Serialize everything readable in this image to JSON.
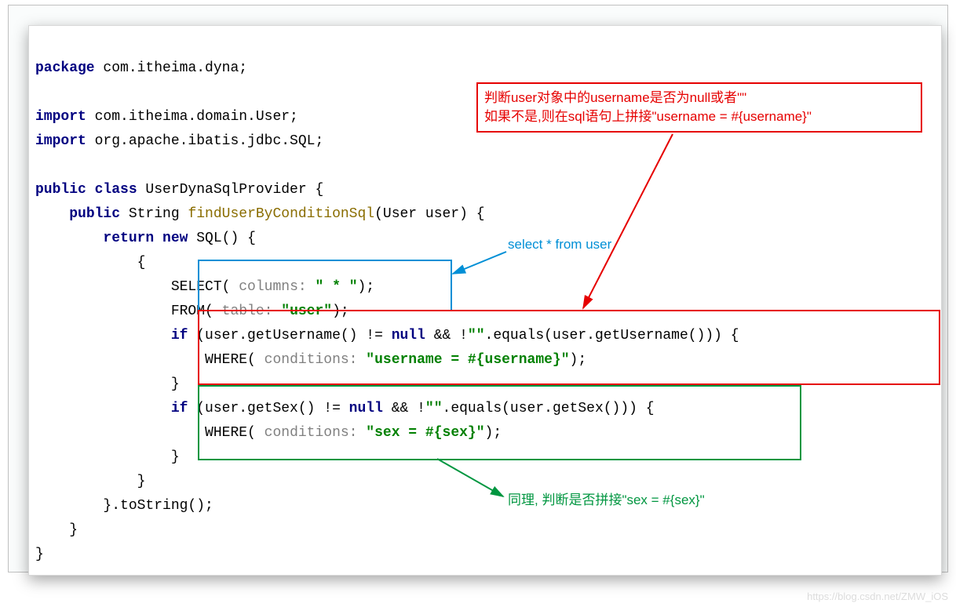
{
  "code": {
    "l1": "package com.itheima.dyna;",
    "l2": "",
    "l3": "import com.itheima.domain.User;",
    "l4": "import org.apache.ibatis.jdbc.SQL;",
    "l5": "",
    "l6_kw": "public class",
    "l6_name": " UserDynaSqlProvider {",
    "l7_pre": "    ",
    "l7_kw": "public",
    "l7_type": " String ",
    "l7_m": "findUserByConditionSql",
    "l7_rest": "(User user) {",
    "l8_pre": "        ",
    "l8_kw": "return new",
    "l8_rest": " SQL() {",
    "l9": "            {",
    "l10_pre": "                SELECT(",
    "l10_hint": " columns: ",
    "l10_str": "\" * \"",
    "l10_rest": ");",
    "l11_pre": "                FROM(",
    "l11_hint": " table: ",
    "l11_str": "\"user\"",
    "l11_rest": ");",
    "l12_pre": "                ",
    "l12_kw": "if",
    "l12_mid1": " (user.getUsername() != ",
    "l12_kw2": "null",
    "l12_mid2": " && !",
    "l12_str": "\"\"",
    "l12_mid3": ".equals(user.getUsername())) {",
    "l13_pre": "                    WHERE(",
    "l13_hint": " conditions: ",
    "l13_str": "\"username = #{username}\"",
    "l13_rest": ");",
    "l14": "                }",
    "l15_pre": "                ",
    "l15_kw": "if",
    "l15_mid1": " (user.getSex() != ",
    "l15_kw2": "null",
    "l15_mid2": " && !",
    "l15_str": "\"\"",
    "l15_mid3": ".equals(user.getSex())) {",
    "l16_pre": "                    WHERE(",
    "l16_hint": " conditions: ",
    "l16_str": "\"sex = #{sex}\"",
    "l16_rest": ");",
    "l17": "                }",
    "l18": "            }",
    "l19": "        }.toString();",
    "l20": "    }",
    "l21": "}"
  },
  "annot": {
    "red_line1": "判断user对象中的username是否为null或者\"\"",
    "red_line2": "如果不是,则在sql语句上拼接\"username = #{username}\"",
    "blue": "select  *  from user",
    "green": "同理, 判断是否拼接\"sex = #{sex}\""
  },
  "watermark": "https://blog.csdn.net/ZMW_iOS"
}
